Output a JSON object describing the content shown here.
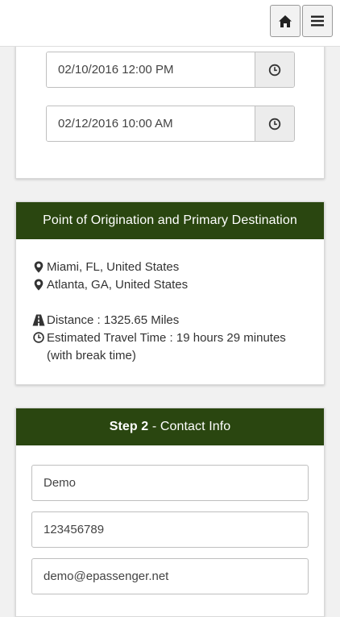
{
  "header": {
    "home_icon": "home-icon",
    "menu_icon": "hamburger-menu-icon"
  },
  "dates": {
    "pickup_datetime": "02/10/2016 12:00 PM",
    "return_datetime": "02/12/2016 10:00 AM",
    "addon_icon": "clock-icon"
  },
  "route": {
    "title": "Point of Origination and Primary Destination",
    "origin": "Miami, FL, United States",
    "destination": "Atlanta, GA, United States",
    "distance": "Distance : 1325.65 Miles",
    "travel_time": "Estimated Travel Time : 19 hours 29 minutes (with break time)"
  },
  "contact": {
    "step_label": "Step 2",
    "step_title": " - Contact Info",
    "name_value": "Demo",
    "phone_value": "123456789",
    "email_value": "demo@epassenger.net"
  },
  "colors": {
    "header_green": "#2a4610",
    "page_background": "#f1f1f1"
  }
}
